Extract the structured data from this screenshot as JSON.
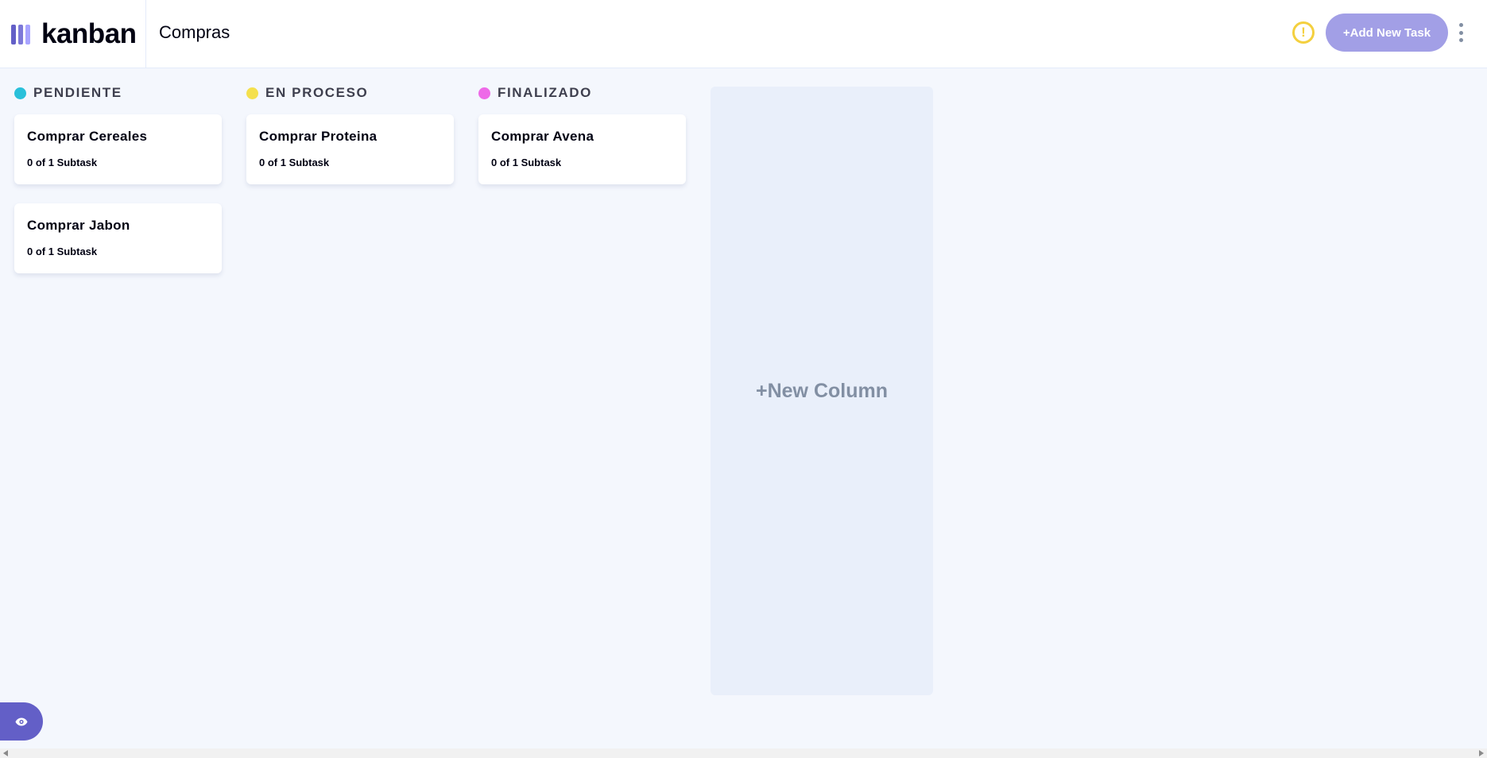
{
  "app": {
    "logo_text": "kanban"
  },
  "header": {
    "board_title": "Compras",
    "warning_glyph": "!",
    "add_task_label": "+Add New Task"
  },
  "colors": {
    "accent": "#635fc7",
    "accent_light": "#a8a4ff",
    "background": "#f4f7fd",
    "warning": "#f4d03f"
  },
  "columns": [
    {
      "name": "PENDIENTE",
      "color": "#29c0da",
      "tasks": [
        {
          "title": "Comprar Cereales",
          "subtasks": "0 of 1 Subtask"
        },
        {
          "title": "Comprar Jabon",
          "subtasks": "0 of 1 Subtask"
        }
      ]
    },
    {
      "name": "EN PROCESO",
      "color": "#f4e04d",
      "tasks": [
        {
          "title": "Comprar Proteina",
          "subtasks": "0 of 1 Subtask"
        }
      ]
    },
    {
      "name": "FINALIZADO",
      "color": "#ee6ae8",
      "tasks": [
        {
          "title": "Comprar Avena",
          "subtasks": "0 of 1 Subtask"
        }
      ]
    }
  ],
  "new_column_label": "+New Column",
  "icons": {
    "warning": "warning-icon",
    "menu": "vertical-ellipsis-icon",
    "show_sidebar": "eye-icon"
  }
}
